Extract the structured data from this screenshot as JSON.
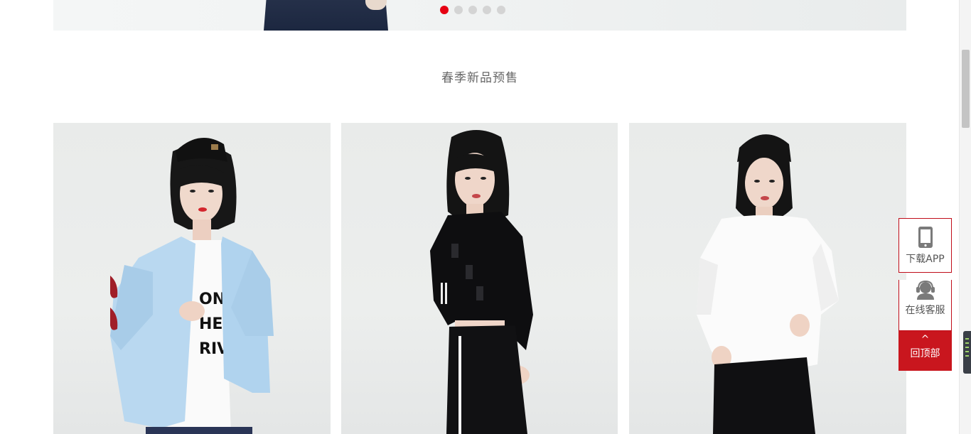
{
  "carousel": {
    "slides_count": 5,
    "active_index": 0,
    "accent_color": "#e60012"
  },
  "section": {
    "title": "春季新品预售"
  },
  "products": [
    {
      "name": "product-card-1",
      "icon": "model-light-blue-shirt"
    },
    {
      "name": "product-card-2",
      "icon": "model-black-sweatshirt"
    },
    {
      "name": "product-card-3",
      "icon": "model-white-tee"
    }
  ],
  "side_tools": {
    "download_app_label": "下载APP",
    "customer_service_label": "在线客服",
    "back_to_top_caret": "^",
    "back_to_top_label": "回顶部",
    "brand_color": "#c9161e"
  }
}
